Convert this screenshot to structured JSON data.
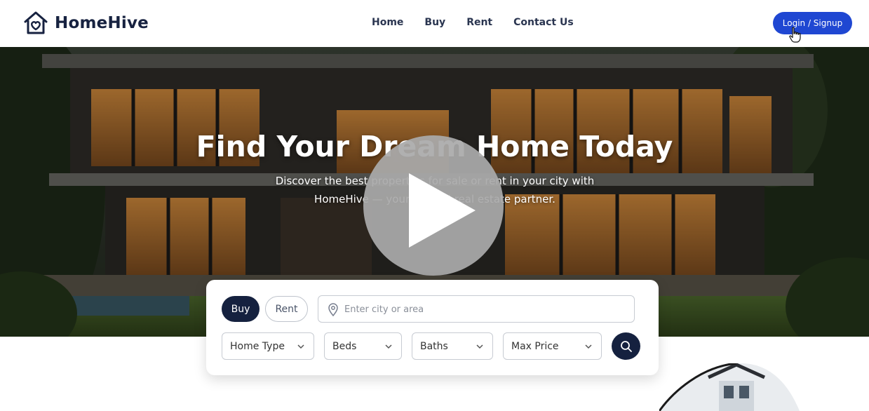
{
  "brand": {
    "name": "HomeHive",
    "logo_icon": "house-heart-icon"
  },
  "nav": {
    "links": [
      "Home",
      "Buy",
      "Rent",
      "Contact Us"
    ],
    "login_label": "Login / Signup"
  },
  "hero": {
    "title": "Find Your Dream Home Today",
    "subtitle": "Discover the best properties for sale or rent in your city with HomeHive — your trusted real estate partner.",
    "overlay_icon": "play-icon"
  },
  "search": {
    "buy_label": "Buy",
    "rent_label": "Rent",
    "selected_mode": "Buy",
    "location_placeholder": "Enter city or area",
    "filters": {
      "home_type": "Home Type",
      "beds": "Beds",
      "baths": "Baths",
      "max_price": "Max Price"
    },
    "search_icon": "search-icon"
  },
  "colors": {
    "accent": "#1f47d2",
    "navy": "#15213f",
    "text": "#2a3550"
  }
}
